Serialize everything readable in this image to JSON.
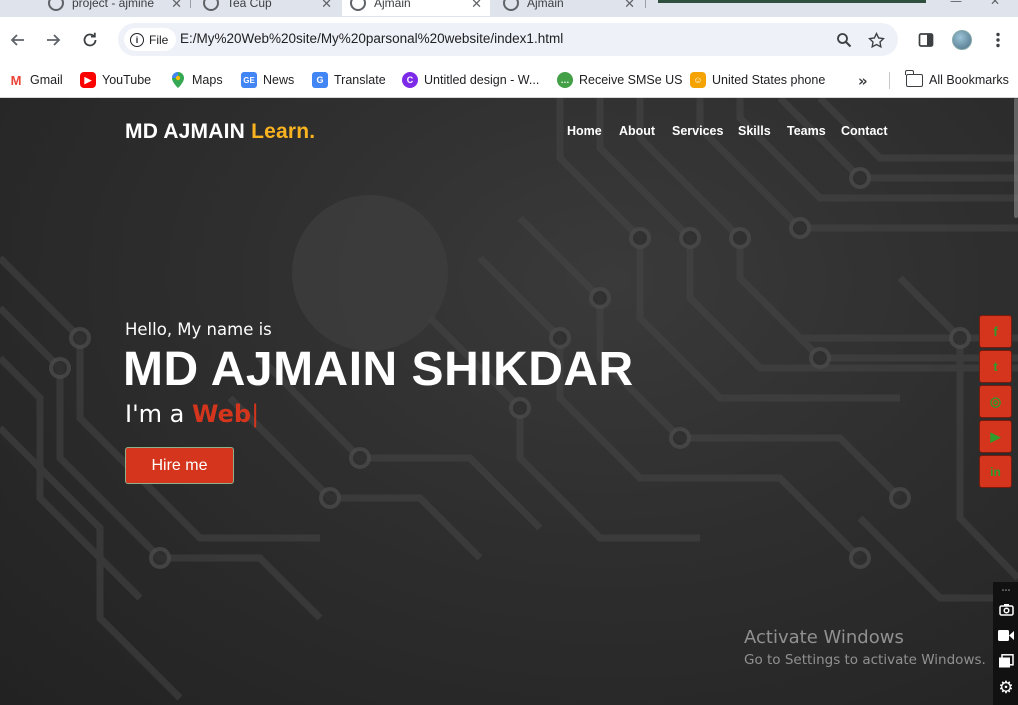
{
  "browser": {
    "tabs": [
      {
        "label": "project - ajmine"
      },
      {
        "label": "Tea Cup"
      },
      {
        "label": "Ajmain",
        "active": true
      },
      {
        "label": "Ajmain"
      }
    ],
    "address": {
      "chip_label": "File",
      "url": "E:/My%20Web%20site/My%20parsonal%20website/index1.html"
    },
    "icons": {
      "back": "arrow-left-icon",
      "forward": "arrow-right-icon",
      "reload": "reload-icon",
      "zoom": "magnifier-icon",
      "bookmark": "star-icon",
      "side_panel": "side-panel-icon",
      "profile": "avatar-icon",
      "menu": "kebab-menu-icon"
    }
  },
  "bookmarks": {
    "items": [
      {
        "label": "Gmail",
        "icon": "gmail-icon",
        "color": "#ea4335"
      },
      {
        "label": "YouTube",
        "icon": "youtube-icon",
        "color": "#ff0000"
      },
      {
        "label": "Maps",
        "icon": "maps-pin-icon",
        "color": "#34a853"
      },
      {
        "label": "News",
        "icon": "google-news-icon",
        "color": "#4285f4"
      },
      {
        "label": "Translate",
        "icon": "translate-icon",
        "color": "#4285f4"
      },
      {
        "label": "Untitled design - W...",
        "icon": "canva-icon",
        "color": "#7d2ae8"
      },
      {
        "label": "Receive SMSe US",
        "icon": "sms-icon",
        "color": "#43a047"
      },
      {
        "label": "United States phone",
        "icon": "phone-app-icon",
        "color": "#f4a300"
      }
    ],
    "more_icon": "double-chevron-icon",
    "all_bookmarks": "All Bookmarks"
  },
  "site": {
    "logo": {
      "main": "MD AJMAIN ",
      "accent": "Learn."
    },
    "menu": [
      "Home",
      "About",
      "Services",
      "Skills",
      "Teams",
      "Contact"
    ],
    "hero": {
      "hello": "Hello, My name is",
      "name": "MD AJMAIN SHIKDAR",
      "role_prefix": "I'm a ",
      "role_typed": "Web",
      "cursor": "|",
      "cta": "Hire me"
    },
    "social": [
      {
        "icon": "facebook-icon",
        "glyph": "f"
      },
      {
        "icon": "twitter-icon",
        "glyph": "t"
      },
      {
        "icon": "instagram-icon",
        "glyph": "◎"
      },
      {
        "icon": "youtube-icon",
        "glyph": "▶"
      },
      {
        "icon": "linkedin-icon",
        "glyph": "in"
      }
    ],
    "colors": {
      "accent": "#f9b320",
      "brand": "#d4351c",
      "social_icon": "#2e9d2e"
    }
  },
  "os_overlay": {
    "activate_title": "Activate Windows",
    "activate_sub": "Go to Settings to activate Windows."
  }
}
